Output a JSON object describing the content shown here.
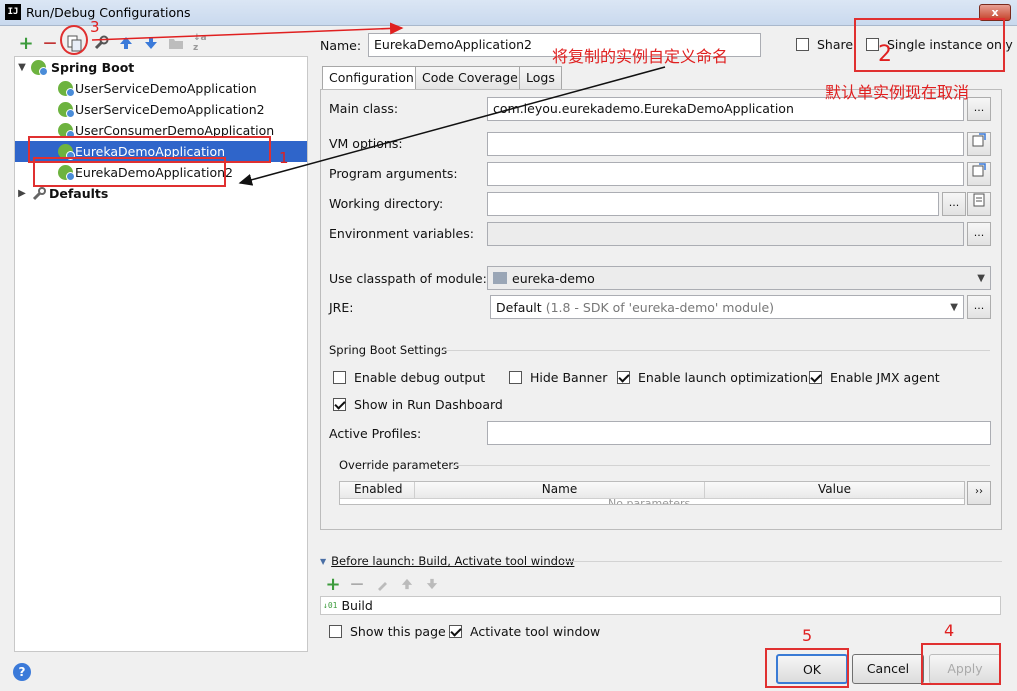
{
  "window": {
    "title": "Run/Debug Configurations",
    "logo": "IJ",
    "close_label": "x"
  },
  "toolbar": {
    "icons": [
      "add-icon",
      "remove-icon",
      "copy-icon",
      "wrench-icon",
      "arrow-up-icon",
      "arrow-down-icon",
      "folder-icon",
      "sort-icon"
    ],
    "add_glyph": "+",
    "remove_glyph": "—",
    "sort_glyph": "↓a z"
  },
  "tree": {
    "group": "Spring Boot",
    "items": [
      "UserServiceDemoApplication",
      "UserServiceDemoApplication2",
      "UserConsumerDemoApplication",
      "EurekaDemoApplication",
      "EurekaDemoApplication2"
    ],
    "selected_index": 3,
    "defaults": "Defaults"
  },
  "header": {
    "name_label": "Name:",
    "name_value": "EurekaDemoApplication2",
    "share_label": "Share",
    "share_checked": false,
    "single_instance_label": "Single instance only",
    "single_instance_checked": false
  },
  "tabs": [
    "Configuration",
    "Code Coverage",
    "Logs"
  ],
  "form": {
    "main_class_label": "Main class:",
    "main_class_value": "com.leyou.eurekademo.EurekaDemoApplication",
    "vm_options_label": "VM options:",
    "program_args_label": "Program arguments:",
    "working_dir_label": "Working directory:",
    "env_vars_label": "Environment variables:",
    "classpath_label": "Use classpath of module:",
    "classpath_value": "eureka-demo",
    "jre_label": "JRE:",
    "jre_value": "Default",
    "jre_detail": "(1.8 - SDK of 'eureka-demo' module)",
    "dots": "..."
  },
  "spring_boot_settings": {
    "title": "Spring Boot Settings",
    "enable_debug_output": {
      "label": "Enable debug output",
      "checked": false
    },
    "hide_banner": {
      "label": "Hide Banner",
      "checked": false
    },
    "enable_launch_optimization": {
      "label": "Enable launch optimization",
      "checked": true
    },
    "enable_jmx_agent": {
      "label": "Enable JMX agent",
      "checked": true
    },
    "show_in_run_dashboard": {
      "label": "Show in Run Dashboard",
      "checked": true
    },
    "active_profiles_label": "Active Profiles:"
  },
  "override": {
    "title": "Override parameters",
    "columns": [
      "Enabled",
      "Name",
      "Value"
    ],
    "empty_text": "No parameters",
    "more_label": "››"
  },
  "before_launch": {
    "title": "Before launch: Build, Activate tool window",
    "task": "Build",
    "show_this_page": {
      "label": "Show this page",
      "checked": false
    },
    "activate_tool_window": {
      "label": "Activate tool window",
      "checked": true
    }
  },
  "buttons": {
    "ok": "OK",
    "cancel": "Cancel",
    "apply": "Apply",
    "help": "?"
  },
  "annotations": {
    "num1": "1",
    "num2": "2",
    "num3": "3",
    "num4": "4",
    "num5": "5",
    "rename_note": "将复制的实例自定义命名",
    "single_note": "默认单实例现在取消"
  },
  "colors": {
    "accent": "#2f65ca",
    "annotation": "#e02020",
    "spring_green": "#6db33f"
  }
}
